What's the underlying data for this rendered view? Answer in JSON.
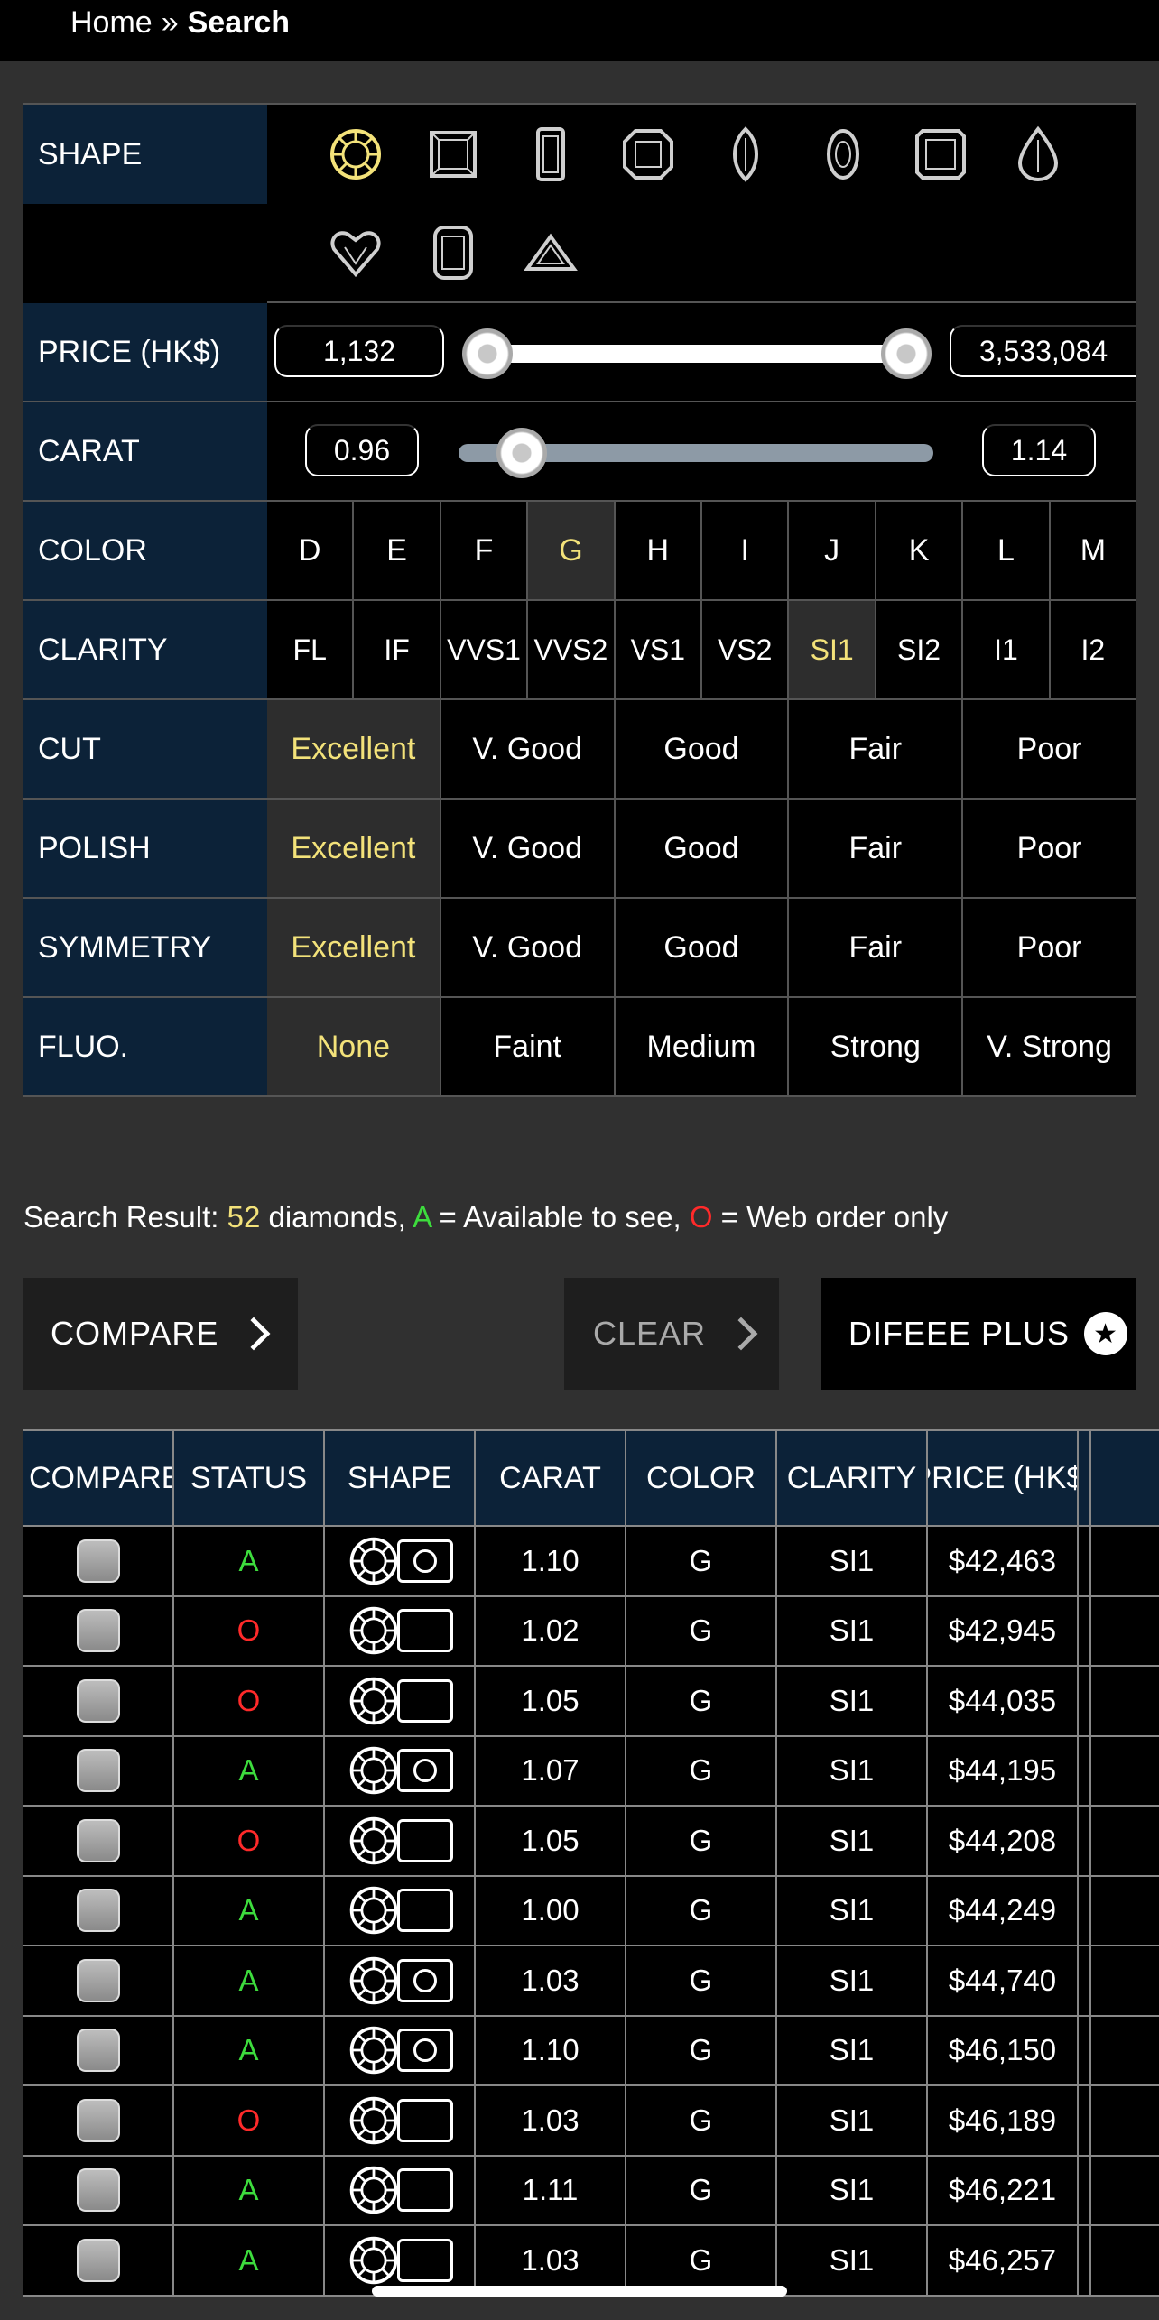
{
  "breadcrumb": {
    "home": "Home",
    "separator": "»",
    "current": "Search"
  },
  "filters": {
    "shape": {
      "label": "SHAPE",
      "icons": [
        "round-shape-icon",
        "princess-shape-icon",
        "emerald-shape-icon",
        "asscher-shape-icon",
        "marquise-shape-icon",
        "oval-shape-icon",
        "radiant-shape-icon",
        "pear-shape-icon",
        "heart-shape-icon",
        "cushion-shape-icon",
        "trillion-shape-icon"
      ],
      "selected": "round-shape-icon"
    },
    "price": {
      "label": "PRICE (HK$)",
      "min": "1,132",
      "max": "3,533,084"
    },
    "carat": {
      "label": "CARAT",
      "min": "0.96",
      "max": "1.14"
    },
    "color": {
      "label": "COLOR",
      "options": [
        "D",
        "E",
        "F",
        "G",
        "H",
        "I",
        "J",
        "K",
        "L",
        "M"
      ],
      "selected": "G"
    },
    "clarity": {
      "label": "CLARITY",
      "options": [
        "FL",
        "IF",
        "VVS1",
        "VVS2",
        "VS1",
        "VS2",
        "SI1",
        "SI2",
        "I1",
        "I2"
      ],
      "selected": "SI1"
    },
    "cut": {
      "label": "CUT",
      "options": [
        "Excellent",
        "V. Good",
        "Good",
        "Fair",
        "Poor"
      ],
      "selected": "Excellent"
    },
    "polish": {
      "label": "POLISH",
      "options": [
        "Excellent",
        "V. Good",
        "Good",
        "Fair",
        "Poor"
      ],
      "selected": "Excellent"
    },
    "symmetry": {
      "label": "SYMMETRY",
      "options": [
        "Excellent",
        "V. Good",
        "Good",
        "Fair",
        "Poor"
      ],
      "selected": "Excellent"
    },
    "fluo": {
      "label": "FLUO.",
      "options": [
        "None",
        "Faint",
        "Medium",
        "Strong",
        "V. Strong"
      ],
      "selected": "None"
    }
  },
  "result": {
    "prefix": "Search Result: ",
    "count": "52",
    "mid": " diamonds, ",
    "a_letter": "A",
    "a_text": " = Available to see, ",
    "o_letter": "O",
    "o_text": " = Web order only"
  },
  "buttons": {
    "compare": "COMPARE",
    "clear": "CLEAR",
    "plus": "DIFEEE PLUS"
  },
  "table": {
    "headers": [
      "COMPARE",
      "STATUS",
      "SHAPE",
      "CARAT",
      "COLOR",
      "CLARITY",
      "PRICE (HK$)"
    ],
    "rows": [
      {
        "status": "A",
        "camera": true,
        "carat": "1.10",
        "color": "G",
        "clarity": "SI1",
        "price": "$42,463"
      },
      {
        "status": "O",
        "camera": false,
        "carat": "1.02",
        "color": "G",
        "clarity": "SI1",
        "price": "$42,945"
      },
      {
        "status": "O",
        "camera": false,
        "carat": "1.05",
        "color": "G",
        "clarity": "SI1",
        "price": "$44,035"
      },
      {
        "status": "A",
        "camera": true,
        "carat": "1.07",
        "color": "G",
        "clarity": "SI1",
        "price": "$44,195"
      },
      {
        "status": "O",
        "camera": false,
        "carat": "1.05",
        "color": "G",
        "clarity": "SI1",
        "price": "$44,208"
      },
      {
        "status": "A",
        "camera": false,
        "carat": "1.00",
        "color": "G",
        "clarity": "SI1",
        "price": "$44,249"
      },
      {
        "status": "A",
        "camera": true,
        "carat": "1.03",
        "color": "G",
        "clarity": "SI1",
        "price": "$44,740"
      },
      {
        "status": "A",
        "camera": true,
        "carat": "1.10",
        "color": "G",
        "clarity": "SI1",
        "price": "$46,150"
      },
      {
        "status": "O",
        "camera": false,
        "carat": "1.03",
        "color": "G",
        "clarity": "SI1",
        "price": "$46,189"
      },
      {
        "status": "A",
        "camera": false,
        "carat": "1.11",
        "color": "G",
        "clarity": "SI1",
        "price": "$46,221"
      },
      {
        "status": "A",
        "camera": false,
        "carat": "1.03",
        "color": "G",
        "clarity": "SI1",
        "price": "$46,257"
      }
    ]
  },
  "colors": {
    "accent": "#f3e27a",
    "available": "#3ddc3d",
    "web_only": "#ff2a2a",
    "label_bg": "#0c2238"
  }
}
